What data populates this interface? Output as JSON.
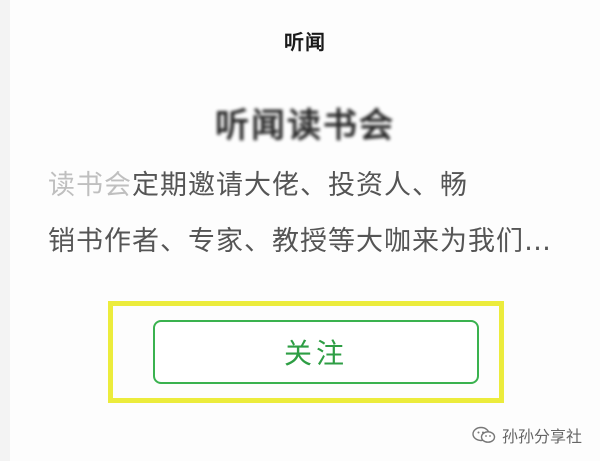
{
  "header": {
    "title": "听闻"
  },
  "account": {
    "name": "听闻读书会"
  },
  "description": {
    "line1_faded": "读书会",
    "line1": "定期邀请大佬、投资人、畅",
    "line2": "销书作者、专家、教授等大咖来为我们…"
  },
  "actions": {
    "follow_label": "关注"
  },
  "watermark": {
    "icon": "wechat-icon",
    "text": "孙孙分享社"
  },
  "colors": {
    "follow_green": "#2e9e44",
    "highlight_yellow": "#ecec3c"
  }
}
